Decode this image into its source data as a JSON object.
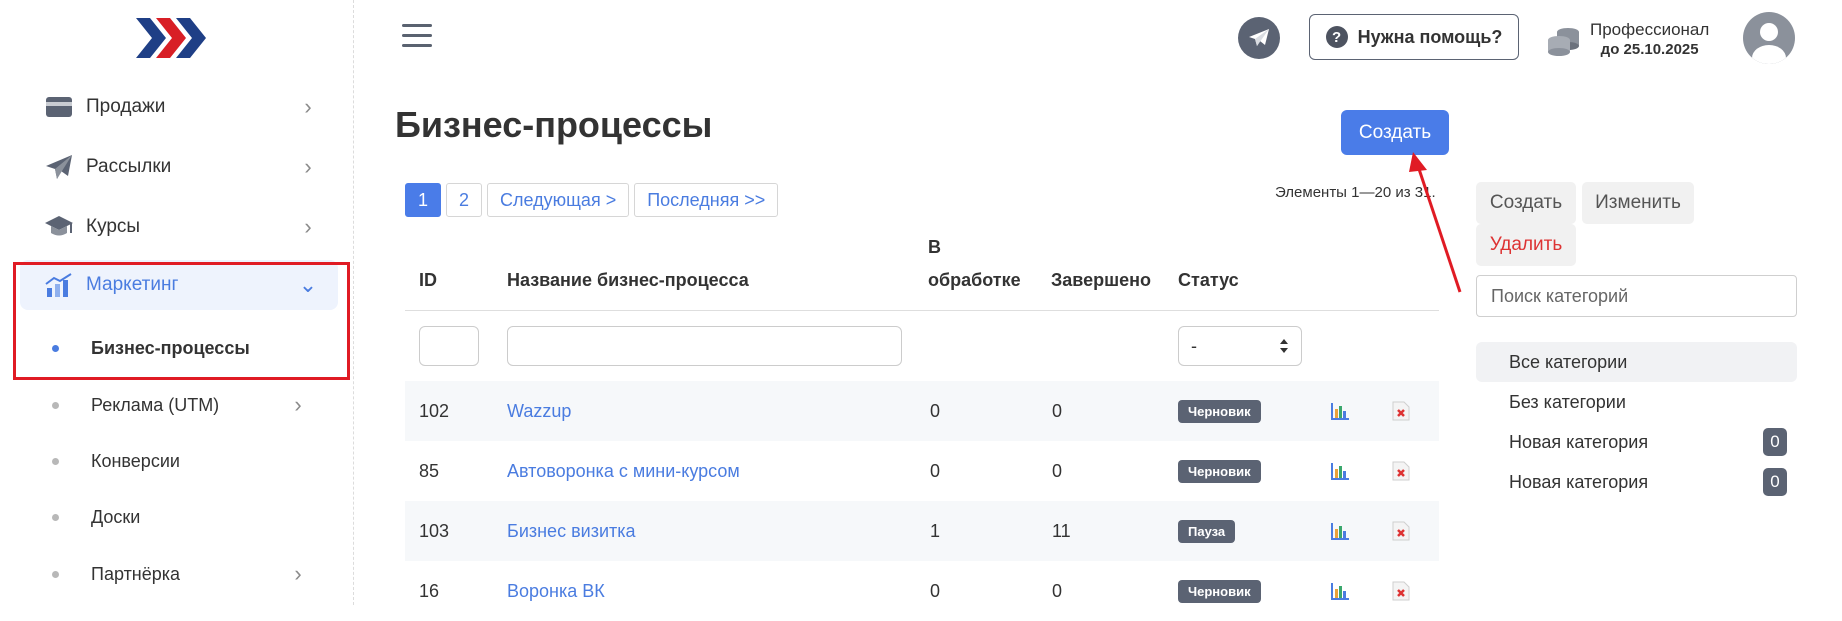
{
  "sidebar": {
    "items": [
      {
        "label": "Продажи",
        "icon": "credit-card-icon"
      },
      {
        "label": "Рассылки",
        "icon": "paper-plane-icon"
      },
      {
        "label": "Курсы",
        "icon": "graduation-cap-icon"
      },
      {
        "label": "Маркетинг",
        "icon": "chart-growth-icon",
        "active": true
      }
    ],
    "subitems": [
      {
        "label": "Бизнес-процессы",
        "current": true
      },
      {
        "label": "Реклама (UTM)"
      },
      {
        "label": "Конверсии"
      },
      {
        "label": "Доски"
      },
      {
        "label": "Партнёрка"
      }
    ]
  },
  "header": {
    "help_label": "Нужна помощь?",
    "plan_title": "Профессионал",
    "plan_date": "до 25.10.2025"
  },
  "main": {
    "title": "Бизнес-процессы",
    "create_label": "Создать",
    "pager": [
      "1",
      "2",
      "Следующая >",
      "Последняя >>"
    ],
    "count_text": "Элементы 1—20 из 31.",
    "columns": {
      "id": "ID",
      "name": "Название бизнес-процесса",
      "processing_1": "В",
      "processing_2": "обработке",
      "done": "Завершено",
      "status": "Статус"
    },
    "status_filter": "-",
    "rows": [
      {
        "id": "102",
        "name": "Wazzup",
        "processing": "0",
        "done": "0",
        "status": "Черновик"
      },
      {
        "id": "85",
        "name": "Автоворонка с мини-курсом",
        "processing": "0",
        "done": "0",
        "status": "Черновик"
      },
      {
        "id": "103",
        "name": "Бизнес визитка",
        "processing": "1",
        "done": "11",
        "status": "Пауза"
      },
      {
        "id": "16",
        "name": "Воронка ВК",
        "processing": "0",
        "done": "0",
        "status": "Черновик"
      }
    ]
  },
  "categories": {
    "create_label": "Создать",
    "edit_label": "Изменить",
    "delete_label": "Удалить",
    "search_placeholder": "Поиск категорий",
    "items": [
      {
        "label": "Все категории"
      },
      {
        "label": "Без категории"
      },
      {
        "label": "Новая категория",
        "count": "0"
      },
      {
        "label": "Новая категория",
        "count": "0"
      }
    ]
  },
  "colors": {
    "accent": "#4a7ce8",
    "annotation_red": "#e01b24",
    "badge": "#5b6373"
  }
}
